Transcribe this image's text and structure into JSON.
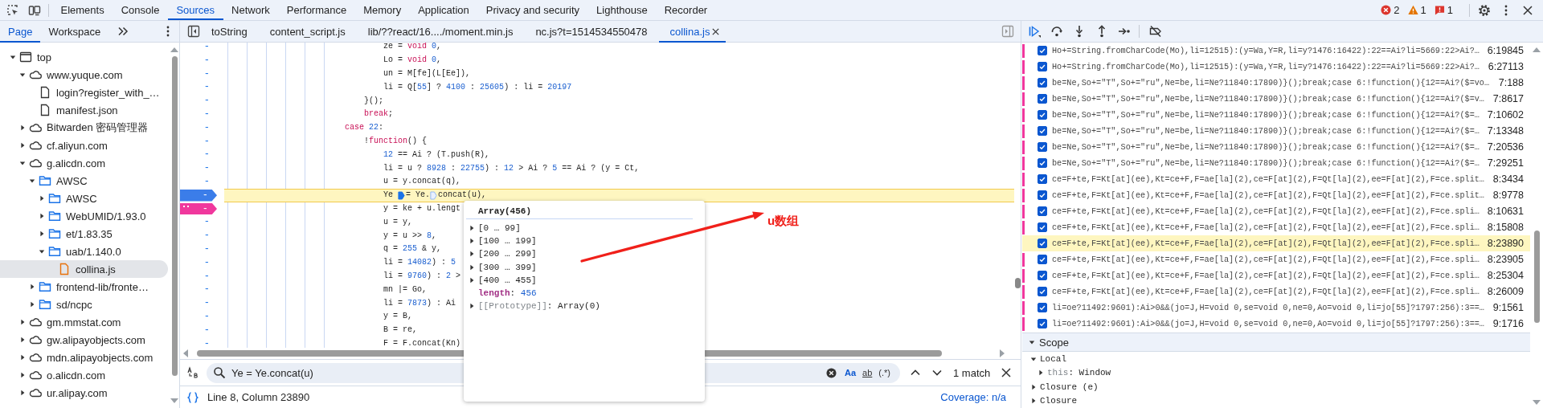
{
  "toolbar": {
    "tabs": [
      {
        "label": "Elements",
        "selected": false
      },
      {
        "label": "Console",
        "selected": false
      },
      {
        "label": "Sources",
        "selected": true
      },
      {
        "label": "Network",
        "selected": false
      },
      {
        "label": "Performance",
        "selected": false
      },
      {
        "label": "Memory",
        "selected": false
      },
      {
        "label": "Application",
        "selected": false
      },
      {
        "label": "Privacy and security",
        "selected": false
      },
      {
        "label": "Lighthouse",
        "selected": false
      },
      {
        "label": "Recorder",
        "selected": false
      }
    ],
    "counts": [
      {
        "kind": "error",
        "value": "2"
      },
      {
        "kind": "warning",
        "value": "1"
      },
      {
        "kind": "issue",
        "value": "1"
      }
    ]
  },
  "sidebar": {
    "tabs": [
      {
        "label": "Page",
        "selected": true
      },
      {
        "label": "Workspace",
        "selected": false
      }
    ],
    "tree": [
      {
        "kind": "frame",
        "label": "top",
        "expanded": true,
        "selected": false,
        "children": [
          {
            "kind": "domain",
            "label": "www.yuque.com",
            "expanded": true,
            "selected": false,
            "children": [
              {
                "kind": "file",
                "label": "login?register_with_…",
                "selected": false
              },
              {
                "kind": "file",
                "label": "manifest.json",
                "selected": false
              }
            ]
          },
          {
            "kind": "domain",
            "label": "Bitwarden 密码管理器",
            "expanded": false,
            "selected": false
          },
          {
            "kind": "domain",
            "label": "cf.aliyun.com",
            "expanded": false,
            "selected": false
          },
          {
            "kind": "domain",
            "label": "g.alicdn.com",
            "expanded": true,
            "selected": false,
            "children": [
              {
                "kind": "folder",
                "label": "AWSC",
                "expanded": true,
                "selected": false,
                "children": [
                  {
                    "kind": "folder",
                    "label": "AWSC",
                    "expanded": false,
                    "selected": false
                  },
                  {
                    "kind": "folder",
                    "label": "WebUMID/1.93.0",
                    "expanded": false,
                    "selected": false
                  },
                  {
                    "kind": "folder",
                    "label": "et/1.83.35",
                    "expanded": false,
                    "selected": false
                  },
                  {
                    "kind": "folder",
                    "label": "uab/1.140.0",
                    "expanded": true,
                    "selected": false,
                    "children": [
                      {
                        "kind": "script",
                        "label": "collina.js",
                        "selected": true
                      }
                    ]
                  }
                ]
              },
              {
                "kind": "folder",
                "label": "frontend-lib/fronte…",
                "expanded": false,
                "selected": false
              },
              {
                "kind": "folder",
                "label": "sd/ncpc",
                "expanded": false,
                "selected": false
              }
            ]
          },
          {
            "kind": "domain",
            "label": "gm.mmstat.com",
            "expanded": false,
            "selected": false
          },
          {
            "kind": "domain",
            "label": "gw.alipayobjects.com",
            "expanded": false,
            "selected": false
          },
          {
            "kind": "domain",
            "label": "mdn.alipayobjects.com",
            "expanded": false,
            "selected": false
          },
          {
            "kind": "domain",
            "label": "o.alicdn.com",
            "expanded": false,
            "selected": false
          },
          {
            "kind": "domain",
            "label": "ur.alipay.com",
            "expanded": false,
            "selected": false
          }
        ]
      }
    ]
  },
  "editor": {
    "tabs": [
      {
        "label": "toString",
        "selected": false,
        "closable": false
      },
      {
        "label": "content_script.js",
        "selected": false,
        "closable": false
      },
      {
        "label": "lib/??react/16..../moment.min.js",
        "selected": false,
        "closable": false
      },
      {
        "label": "nc.js?t=1514534550478",
        "selected": false,
        "closable": false
      },
      {
        "label": "collina.js",
        "selected": true,
        "closable": true
      }
    ],
    "lines": [
      {
        "gutter": "-",
        "current": false,
        "tokens": [
          {
            "text": "                                ze = ",
            "kind": "plain"
          },
          {
            "text": "void",
            "kind": "keyword"
          },
          {
            "text": " 0",
            "kind": "number"
          },
          {
            "text": ",",
            "kind": "plain"
          }
        ]
      },
      {
        "gutter": "-",
        "current": false,
        "tokens": [
          {
            "text": "                                Lo = ",
            "kind": "plain"
          },
          {
            "text": "void",
            "kind": "keyword"
          },
          {
            "text": " 0",
            "kind": "number"
          },
          {
            "text": ",",
            "kind": "plain"
          }
        ]
      },
      {
        "gutter": "-",
        "current": false,
        "tokens": [
          {
            "text": "                                un = M[fe](L[Ee]),",
            "kind": "plain"
          }
        ]
      },
      {
        "gutter": "-",
        "current": false,
        "tokens": [
          {
            "text": "                                li = Q[",
            "kind": "plain"
          },
          {
            "text": "55",
            "kind": "number"
          },
          {
            "text": "] ? ",
            "kind": "plain"
          },
          {
            "text": "4100",
            "kind": "number"
          },
          {
            "text": " : ",
            "kind": "plain"
          },
          {
            "text": "25605",
            "kind": "number"
          },
          {
            "text": ") : li = ",
            "kind": "plain"
          },
          {
            "text": "20197",
            "kind": "number"
          }
        ]
      },
      {
        "gutter": "-",
        "current": false,
        "tokens": [
          {
            "text": "                            }();",
            "kind": "plain"
          }
        ]
      },
      {
        "gutter": "-",
        "current": false,
        "tokens": [
          {
            "text": "                            break",
            "kind": "keyword"
          },
          {
            "text": ";",
            "kind": "plain"
          }
        ]
      },
      {
        "gutter": "-",
        "current": false,
        "tokens": [
          {
            "text": "                        case",
            "kind": "keyword"
          },
          {
            "text": " 22",
            "kind": "number"
          },
          {
            "text": ":",
            "kind": "plain"
          }
        ]
      },
      {
        "gutter": "-",
        "current": false,
        "tokens": [
          {
            "text": "                            !",
            "kind": "plain"
          },
          {
            "text": "function",
            "kind": "keyword"
          },
          {
            "text": "() {",
            "kind": "plain"
          }
        ]
      },
      {
        "gutter": "-",
        "current": false,
        "tokens": [
          {
            "text": "                                12",
            "kind": "number"
          },
          {
            "text": " == Ai ? (T.push(R),",
            "kind": "plain"
          }
        ]
      },
      {
        "gutter": "-",
        "current": false,
        "tokens": [
          {
            "text": "                                li = u ? ",
            "kind": "plain"
          },
          {
            "text": "8928",
            "kind": "number"
          },
          {
            "text": " : ",
            "kind": "plain"
          },
          {
            "text": "22755",
            "kind": "number"
          },
          {
            "text": ") : ",
            "kind": "plain"
          },
          {
            "text": "12",
            "kind": "number"
          },
          {
            "text": " > Ai ? ",
            "kind": "plain"
          },
          {
            "text": "5",
            "kind": "number"
          },
          {
            "text": " == Ai ? (y = Ct,",
            "kind": "plain"
          }
        ]
      },
      {
        "gutter": "-",
        "current": false,
        "tokens": [
          {
            "text": "                                u = y.concat(q),",
            "kind": "plain"
          }
        ]
      },
      {
        "gutter": "-",
        "current": true,
        "marker": {
          "kind": "breakpoint"
        },
        "tokens": [
          {
            "text": "                                Ye ",
            "kind": "plain"
          },
          {
            "kind": "breakpoint",
            "active": true
          },
          {
            "text": "= Ye.",
            "kind": "plain"
          },
          {
            "kind": "breakpoint",
            "active": false
          },
          {
            "text": "concat(u),",
            "kind": "plain"
          }
        ]
      },
      {
        "gutter": "-",
        "current": false,
        "marker": {
          "kind": "logpoint"
        },
        "tokens": [
          {
            "text": "                                y = ke + u.lengt",
            "kind": "plain"
          }
        ]
      },
      {
        "gutter": "-",
        "current": false,
        "tokens": [
          {
            "text": "                                u = y,",
            "kind": "plain"
          }
        ]
      },
      {
        "gutter": "-",
        "current": false,
        "tokens": [
          {
            "text": "                                y = u >> ",
            "kind": "plain"
          },
          {
            "text": "8",
            "kind": "number"
          },
          {
            "text": ",",
            "kind": "plain"
          }
        ]
      },
      {
        "gutter": "-",
        "current": false,
        "tokens": [
          {
            "text": "                                q = ",
            "kind": "plain"
          },
          {
            "text": "255",
            "kind": "number"
          },
          {
            "text": " & y,",
            "kind": "plain"
          }
        ]
      },
      {
        "gutter": "-",
        "current": false,
        "tokens": [
          {
            "text": "                                li = ",
            "kind": "plain"
          },
          {
            "text": "14082",
            "kind": "number"
          },
          {
            "text": ") : ",
            "kind": "plain"
          },
          {
            "text": "5",
            "kind": "number"
          }
        ]
      },
      {
        "gutter": "-",
        "current": false,
        "tokens": [
          {
            "text": "                                li = ",
            "kind": "plain"
          },
          {
            "text": "9760",
            "kind": "number"
          },
          {
            "text": ") : ",
            "kind": "plain"
          },
          {
            "text": "2",
            "kind": "number"
          },
          {
            "text": " >",
            "kind": "plain"
          }
        ]
      },
      {
        "gutter": "-",
        "current": false,
        "tokens": [
          {
            "text": "                                mn |= Go,",
            "kind": "plain"
          }
        ]
      },
      {
        "gutter": "-",
        "current": false,
        "tokens": [
          {
            "text": "                                li = ",
            "kind": "plain"
          },
          {
            "text": "7873",
            "kind": "number"
          },
          {
            "text": ") : Ai",
            "kind": "plain"
          }
        ]
      },
      {
        "gutter": "-",
        "current": false,
        "tokens": [
          {
            "text": "                                y = B,",
            "kind": "plain"
          }
        ]
      },
      {
        "gutter": "-",
        "current": false,
        "tokens": [
          {
            "text": "                                B = re,",
            "kind": "plain"
          }
        ]
      },
      {
        "gutter": "-",
        "current": false,
        "tokens": [
          {
            "text": "                                F = F.concat(Kn)",
            "kind": "plain"
          }
        ]
      }
    ],
    "search": {
      "value": "Ye = Ye.concat(u)",
      "options": [
        {
          "label": "Aa",
          "selected": true
        },
        {
          "label": "ab",
          "selected": false
        },
        {
          "label": "(.*)",
          "selected": false
        }
      ],
      "matches": "1 match"
    },
    "status": {
      "position": "Line 8, Column 23890",
      "coverage": "Coverage: n/a"
    }
  },
  "popover": {
    "title": "Array(456)",
    "rows": [
      {
        "expanded": false,
        "tokens": [
          {
            "text": "[0 … 99]",
            "kind": "plain"
          }
        ]
      },
      {
        "expanded": false,
        "tokens": [
          {
            "text": "[100 … 199]",
            "kind": "plain"
          }
        ]
      },
      {
        "expanded": false,
        "tokens": [
          {
            "text": "[200 … 299]",
            "kind": "plain"
          }
        ]
      },
      {
        "expanded": false,
        "tokens": [
          {
            "text": "[300 … 399]",
            "kind": "plain"
          }
        ]
      },
      {
        "expanded": false,
        "tokens": [
          {
            "text": "[400 … 455]",
            "kind": "plain"
          }
        ]
      },
      {
        "tokens": [
          {
            "text": "length",
            "kind": "key"
          },
          {
            "text": ": ",
            "kind": "plain"
          },
          {
            "text": "456",
            "kind": "number"
          }
        ]
      },
      {
        "expanded": false,
        "tokens": [
          {
            "text": "[[Prototype]]",
            "kind": "dim"
          },
          {
            "text": ": Array(0)",
            "kind": "plain"
          }
        ]
      }
    ]
  },
  "annotation": {
    "label": "u数组"
  },
  "debugger": {
    "breakpoints": [
      {
        "code": "Ho+=String.fromCharCode(Mo),li=12515):(y=Wa,Y=R,li=y?1476:16422):22==Ai?li=5669:22>Ai?…",
        "location": "6:19845",
        "checked": true,
        "selected": false
      },
      {
        "code": "Ho+=String.fromCharCode(Mo),li=12515):(y=Wa,Y=R,li=y?1476:16422):22==Ai?li=5669:22>Ai?…",
        "location": "6:27113",
        "checked": true,
        "selected": false
      },
      {
        "code": "be=Ne,So+=\"T\",So+=\"ru\",Ne=be,li=Ne?11840:17890)}();break;case 6:!function(){12==Ai?($=vo…",
        "location": "7:188",
        "checked": true,
        "selected": false
      },
      {
        "code": "be=Ne,So+=\"T\",So+=\"ru\",Ne=be,li=Ne?11840:17890)}();break;case 6:!function(){12==Ai?($=v…",
        "location": "7:8617",
        "checked": true,
        "selected": false
      },
      {
        "code": "be=Ne,So+=\"T\",So+=\"ru\",Ne=be,li=Ne?11840:17890)}();break;case 6:!function(){12==Ai?($=…",
        "location": "7:10602",
        "checked": true,
        "selected": false
      },
      {
        "code": "be=Ne,So+=\"T\",So+=\"ru\",Ne=be,li=Ne?11840:17890)}();break;case 6:!function(){12==Ai?($=…",
        "location": "7:13348",
        "checked": true,
        "selected": false
      },
      {
        "code": "be=Ne,So+=\"T\",So+=\"ru\",Ne=be,li=Ne?11840:17890)}();break;case 6:!function(){12==Ai?($=…",
        "location": "7:20536",
        "checked": true,
        "selected": false
      },
      {
        "code": "be=Ne,So+=\"T\",So+=\"ru\",Ne=be,li=Ne?11840:17890)}();break;case 6:!function(){12==Ai?($=…",
        "location": "7:29251",
        "checked": true,
        "selected": false
      },
      {
        "code": "ce=F+te,F=Kt[at](ee),Kt=ce+F,F=ae[la](2),ce=F[at](2),F=Qt[la](2),ee=F[at](2),F=ce.split…",
        "location": "8:3434",
        "checked": true,
        "selected": false
      },
      {
        "code": "ce=F+te,F=Kt[at](ee),Kt=ce+F,F=ae[la](2),ce=F[at](2),F=Qt[la](2),ee=F[at](2),F=ce.split…",
        "location": "8:9778",
        "checked": true,
        "selected": false
      },
      {
        "code": "ce=F+te,F=Kt[at](ee),Kt=ce+F,F=ae[la](2),ce=F[at](2),F=Qt[la](2),ee=F[at](2),F=ce.spli…",
        "location": "8:10631",
        "checked": true,
        "selected": false
      },
      {
        "code": "ce=F+te,F=Kt[at](ee),Kt=ce+F,F=ae[la](2),ce=F[at](2),F=Qt[la](2),ee=F[at](2),F=ce.spli…",
        "location": "8:15808",
        "checked": true,
        "selected": false
      },
      {
        "code": "ce=F+te,F=Kt[at](ee),Kt=ce+F,F=ae[la](2),ce=F[at](2),F=Qt[la](2),ee=F[at](2),F=ce.spli…",
        "location": "8:23890",
        "checked": true,
        "selected": true
      },
      {
        "code": "ce=F+te,F=Kt[at](ee),Kt=ce+F,F=ae[la](2),ce=F[at](2),F=Qt[la](2),ee=F[at](2),F=ce.spli…",
        "location": "8:23905",
        "checked": true,
        "selected": false
      },
      {
        "code": "ce=F+te,F=Kt[at](ee),Kt=ce+F,F=ae[la](2),ce=F[at](2),F=Qt[la](2),ee=F[at](2),F=ce.spli…",
        "location": "8:25304",
        "checked": true,
        "selected": false
      },
      {
        "code": "ce=F+te,F=Kt[at](ee),Kt=ce+F,F=ae[la](2),ce=F[at](2),F=Qt[la](2),ee=F[at](2),F=ce.spli…",
        "location": "8:26009",
        "checked": true,
        "selected": false
      },
      {
        "code": "li=oe?11492:9601):Ai>0&&(jo=J,H=void 0,se=void 0,ne=0,Ao=void 0,li=jo[55]?1797:256):3==…",
        "location": "9:1561",
        "checked": true,
        "selected": false
      },
      {
        "code": "li=oe?11492:9601):Ai>0&&(jo=J,H=void 0,se=void 0,ne=0,Ao=void 0,li=jo[55]?1797:256):3==…",
        "location": "9:1716",
        "checked": true,
        "selected": false
      }
    ],
    "scope": {
      "title": "Scope",
      "expanded": true,
      "items": [
        {
          "expanded": true,
          "tokens": [
            {
              "text": "Local",
              "kind": "plain"
            }
          ],
          "children": [
            {
              "expanded": false,
              "tokens": [
                {
                  "text": "this",
                  "kind": "dim"
                },
                {
                  "text": ": Window",
                  "kind": "plain"
                }
              ]
            }
          ]
        },
        {
          "expanded": false,
          "tokens": [
            {
              "text": "Closure (e)",
              "kind": "plain"
            }
          ]
        },
        {
          "expanded": false,
          "tokens": [
            {
              "text": "Closure",
              "kind": "plain"
            }
          ]
        }
      ]
    }
  }
}
